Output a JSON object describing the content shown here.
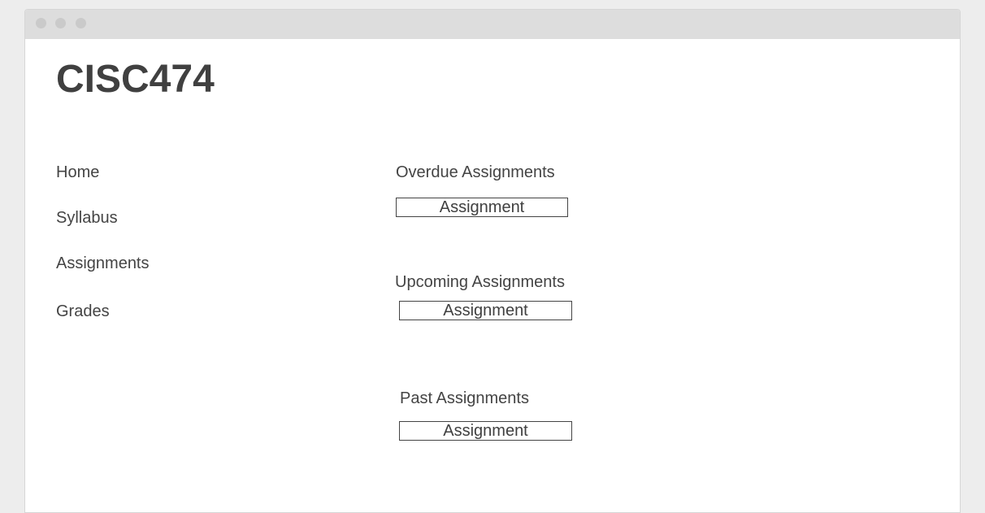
{
  "page": {
    "title": "CISC474"
  },
  "nav": {
    "items": [
      {
        "label": "Home"
      },
      {
        "label": "Syllabus"
      },
      {
        "label": "Assignments"
      },
      {
        "label": "Grades"
      }
    ]
  },
  "sections": [
    {
      "title": "Overdue Assignments",
      "items": [
        {
          "label": "Assignment"
        }
      ]
    },
    {
      "title": "Upcoming Assignments",
      "items": [
        {
          "label": "Assignment"
        }
      ]
    },
    {
      "title": "Past Assignments",
      "items": [
        {
          "label": "Assignment"
        }
      ]
    }
  ],
  "colors": {
    "text": "#444444",
    "window_chrome": "#dddddd",
    "window_dots": "#cacaca",
    "background": "#ededed"
  }
}
